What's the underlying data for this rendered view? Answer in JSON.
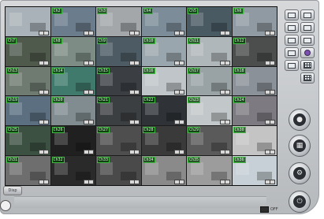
{
  "statusbar": {
    "pill_label": "Disp"
  },
  "footer": {
    "off_label": "OFF"
  },
  "channels": [
    {
      "label": "",
      "bg": "#a9b2b8"
    },
    {
      "label": "Ch2",
      "bg": "#6b7c8c"
    },
    {
      "label": "Ch3",
      "bg": "#a3a7aa"
    },
    {
      "label": "Ch4",
      "bg": "#7c8d99"
    },
    {
      "label": "Ch5",
      "bg": "#4a5a63"
    },
    {
      "label": "Ch6",
      "bg": "#8f9aa2"
    },
    {
      "label": "Ch7",
      "bg": "#4f5a4d"
    },
    {
      "label": "Ch8",
      "bg": "#7d8c84"
    },
    {
      "label": "Ch9",
      "bg": "#4c5b64"
    },
    {
      "label": "Ch10",
      "bg": "#9aa6ad"
    },
    {
      "label": "Ch11",
      "bg": "#b0b7ba"
    },
    {
      "label": "Ch12",
      "bg": "#4b4e4c"
    },
    {
      "label": "Ch13",
      "bg": "#6f7b70"
    },
    {
      "label": "Ch14",
      "bg": "#3f7a6c"
    },
    {
      "label": "Ch15",
      "bg": "#3b3f44"
    },
    {
      "label": "Ch16",
      "bg": "#bfc5c8"
    },
    {
      "label": "Ch17",
      "bg": "#99a3a6"
    },
    {
      "label": "Ch18",
      "bg": "#8a9198"
    },
    {
      "label": "Ch19",
      "bg": "#5b6f80"
    },
    {
      "label": "Ch20",
      "bg": "#818c90"
    },
    {
      "label": "Ch21",
      "bg": "#3c3f42"
    },
    {
      "label": "Ch22",
      "bg": "#2f3337"
    },
    {
      "label": "Ch23",
      "bg": "#c2c7c9"
    },
    {
      "label": "Ch24",
      "bg": "#7e7a82"
    },
    {
      "label": "Ch25",
      "bg": "#3d5142"
    },
    {
      "label": "Ch26",
      "bg": "#202020"
    },
    {
      "label": "Ch27",
      "bg": "#4e4e4e"
    },
    {
      "label": "Ch28",
      "bg": "#3a3a3a"
    },
    {
      "label": "Ch29",
      "bg": "#5a5a5a"
    },
    {
      "label": "Ch30",
      "bg": "#c4c4c4"
    },
    {
      "label": "Ch31",
      "bg": "#6e6e6e"
    },
    {
      "label": "Ch32",
      "bg": "#2a2a2a"
    },
    {
      "label": "Ch33",
      "bg": "#4a4a4a"
    },
    {
      "label": "Ch34",
      "bg": "#8a8a8a"
    },
    {
      "label": "Ch35",
      "bg": "#9c9c9c"
    },
    {
      "label": "Ch36",
      "bg": "#c7d0d6"
    }
  ],
  "side_buttons": [
    {
      "name": "layout-1x1-button",
      "icon": "window-icon"
    },
    {
      "name": "layout-2x2-button",
      "icon": "window-icon"
    },
    {
      "name": "layout-3x3-button",
      "icon": "window-icon"
    },
    {
      "name": "layout-4x4-button",
      "icon": "window-icon"
    },
    {
      "name": "layout-5x5-button",
      "icon": "window-icon"
    },
    {
      "name": "layout-6x6-button",
      "icon": "window-icon"
    },
    {
      "name": "layout-custom-button",
      "icon": "window-icon"
    },
    {
      "name": "playback-button",
      "icon": "play-icon"
    },
    {
      "name": "layout-8x8-button",
      "icon": "window-icon"
    },
    {
      "name": "grid-view-button",
      "icon": "grid-icon"
    },
    {
      "name": "grid-view-small-button",
      "icon": "grid-icon"
    }
  ],
  "round_buttons": [
    {
      "name": "record-button",
      "icon": "record-icon",
      "glyph": "●"
    },
    {
      "name": "sequence-button",
      "icon": "sequence-icon",
      "glyph": "▦"
    },
    {
      "name": "settings-button",
      "icon": "gear-icon",
      "glyph": "⚙"
    },
    {
      "name": "power-button",
      "icon": "power-icon",
      "glyph": "⏻"
    }
  ]
}
